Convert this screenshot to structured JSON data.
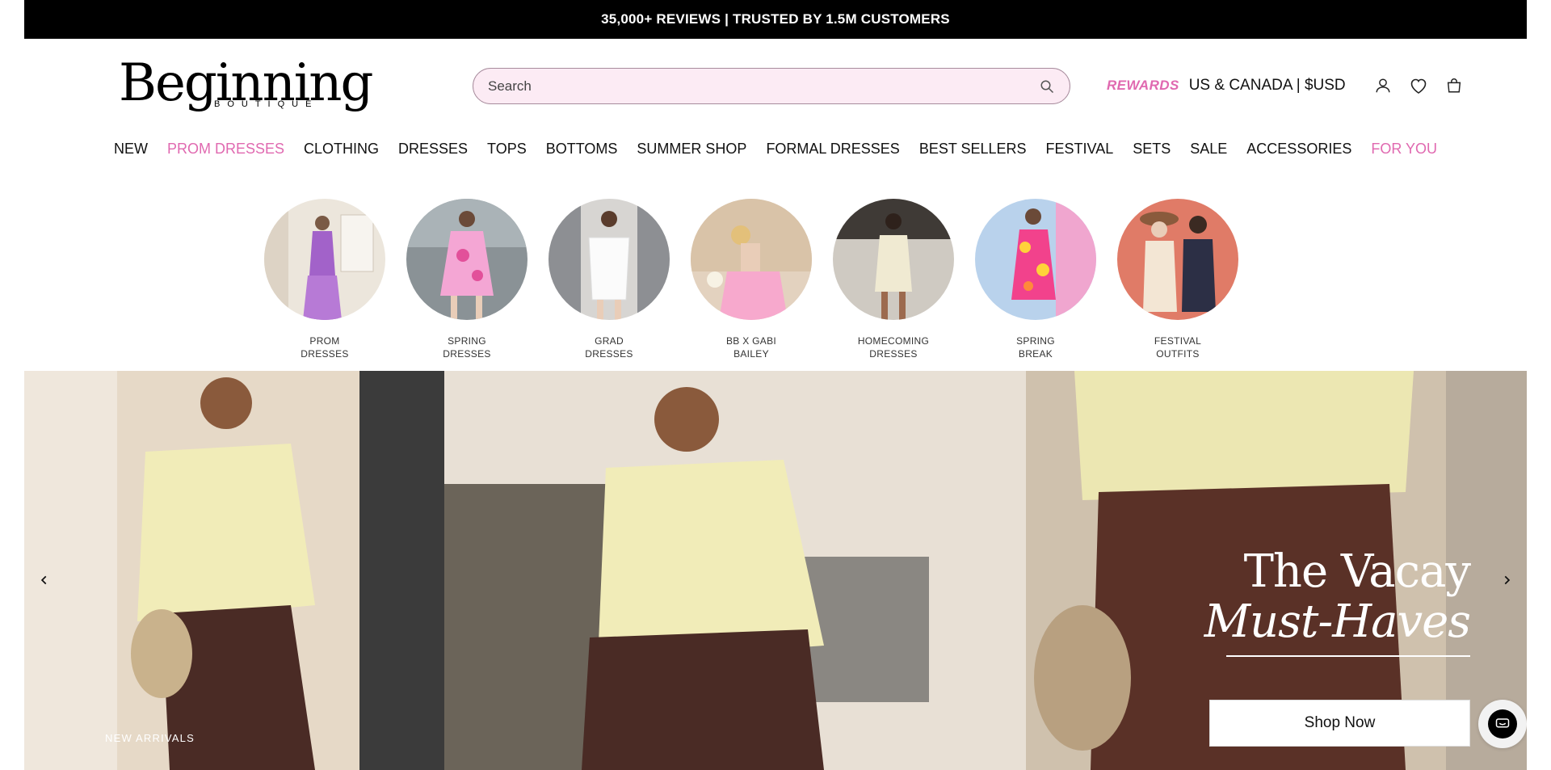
{
  "announcement": "35,000+ REVIEWS | TRUSTED BY 1.5M CUSTOMERS",
  "brand": {
    "name": "Beginning",
    "sub": "BOUTIQUE"
  },
  "search": {
    "placeholder": "Search",
    "value": ""
  },
  "utility": {
    "rewards": "REWARDS",
    "region": "US & CANADA | $USD"
  },
  "icons": {
    "search": "search-icon",
    "account": "user-icon",
    "wishlist": "heart-icon",
    "cart": "cart-icon",
    "prev": "chevron-left-icon",
    "next": "chevron-right-icon",
    "chat": "chat-icon"
  },
  "nav": [
    {
      "label": "NEW",
      "pink": false
    },
    {
      "label": "PROM DRESSES",
      "pink": true
    },
    {
      "label": "CLOTHING",
      "pink": false
    },
    {
      "label": "DRESSES",
      "pink": false
    },
    {
      "label": "TOPS",
      "pink": false
    },
    {
      "label": "BOTTOMS",
      "pink": false
    },
    {
      "label": "SUMMER SHOP",
      "pink": false
    },
    {
      "label": "FORMAL DRESSES",
      "pink": false
    },
    {
      "label": "BEST SELLERS",
      "pink": false
    },
    {
      "label": "FESTIVAL",
      "pink": false
    },
    {
      "label": "SETS",
      "pink": false
    },
    {
      "label": "SALE",
      "pink": false
    },
    {
      "label": "ACCESSORIES",
      "pink": false
    },
    {
      "label": "FOR YOU",
      "pink": true
    }
  ],
  "categories": [
    {
      "line1": "PROM",
      "line2": "DRESSES"
    },
    {
      "line1": "SPRING",
      "line2": "DRESSES"
    },
    {
      "line1": "GRAD",
      "line2": "DRESSES"
    },
    {
      "line1": "BB X GABI",
      "line2": "BAILEY"
    },
    {
      "line1": "HOMECOMING",
      "line2": "DRESSES"
    },
    {
      "line1": "SPRING",
      "line2": "BREAK"
    },
    {
      "line1": "FESTIVAL",
      "line2": "OUTFITS"
    }
  ],
  "hero": {
    "tag": "NEW ARRIVALS",
    "headline_line1": "The Vacay",
    "headline_line2": "Must-Haves",
    "cta": "Shop Now"
  },
  "colors": {
    "accent": "#e069b0",
    "search_bg": "#fcebf4",
    "bar": "#000000"
  }
}
